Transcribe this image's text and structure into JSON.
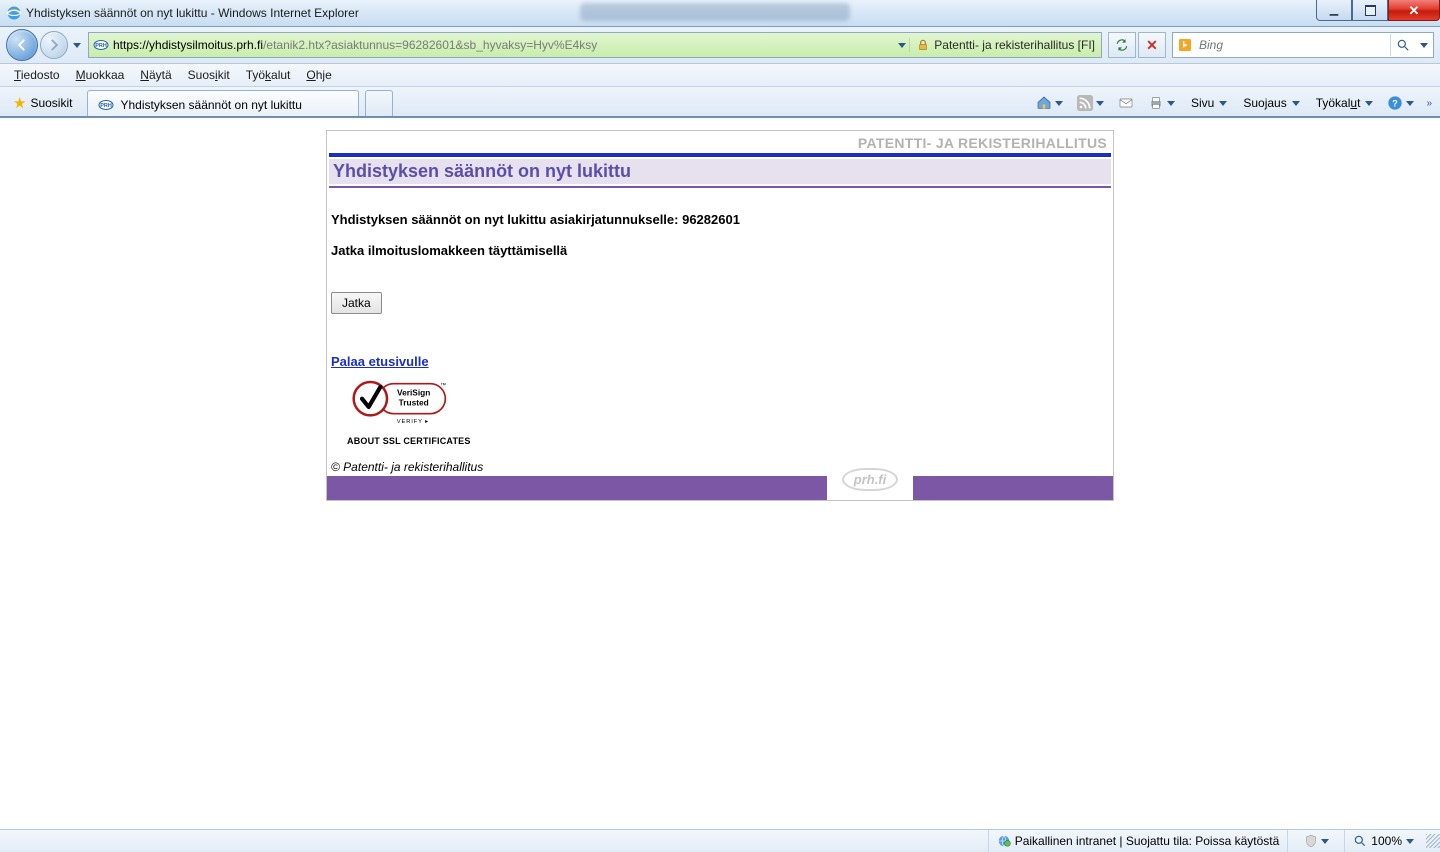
{
  "window": {
    "title": "Yhdistyksen säännöt on nyt lukittu - Windows Internet Explorer"
  },
  "address_bar": {
    "protocol_host": "https://yhdistysilmoitus.prh.fi",
    "path": "/etanik2.htx?asiaktunnus=96282601&sb_hyvaksy=Hyv%E4ksy",
    "security_text": "Patentti- ja rekisterihallitus [FI]"
  },
  "search": {
    "placeholder": "Bing"
  },
  "menu": {
    "items": [
      "Tiedosto",
      "Muokkaa",
      "Näytä",
      "Suosikit",
      "Työkalut",
      "Ohje"
    ]
  },
  "favorites": {
    "label": "Suosikit"
  },
  "tab": {
    "title": "Yhdistyksen säännöt on nyt lukittu"
  },
  "command_bar": {
    "page": "Sivu",
    "safety": "Suojaus",
    "tools": "Työkalut"
  },
  "content": {
    "org_header": "PATENTTI- JA REKISTERIHALLITUS",
    "heading": "Yhdistyksen säännöt on nyt lukittu",
    "line1": "Yhdistyksen säännöt on nyt lukittu asiakirjatunnukselle: 96282601",
    "line2": "Jatka ilmoituslomakkeen täyttämisellä",
    "button": "Jatka",
    "back_link": "Palaa etusivulle",
    "verisign_line1": "VeriSign",
    "verisign_line2": "Trusted",
    "verisign_verify": "VERIFY ▸",
    "ssl_caption": "ABOUT SSL CERTIFICATES",
    "copyright": "© Patentti- ja rekisterihallitus",
    "footer_logo": "prh.fi"
  },
  "status": {
    "zone": "Paikallinen intranet | Suojattu tila: Poissa käytöstä",
    "zoom": "100%"
  }
}
